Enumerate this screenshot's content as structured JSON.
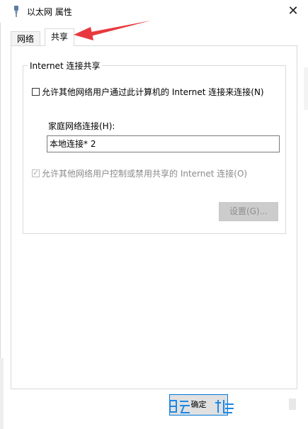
{
  "window": {
    "title": "以太网 属性",
    "close_glyph": "✕"
  },
  "tabs": [
    {
      "label": "网络",
      "active": false
    },
    {
      "label": "共享",
      "active": true
    }
  ],
  "sharing": {
    "group_title": "Internet 连接共享",
    "allow_connect_label": "允许其他网络用户通过此计算机的 Internet 连接来连接(N)",
    "allow_connect_checked": false,
    "home_label": "家庭网络连接(H):",
    "home_value": "本地连接* 2",
    "allow_control_label": "允许其他网络用户控制或禁用共享的 Internet 连接(O)",
    "allow_control_checked": true,
    "settings_button": "设置(G)..."
  },
  "footer": {
    "ok_button": "确定"
  },
  "colors": {
    "annotation_arrow": "#e8383d",
    "focus_border": "#0078d7",
    "watermark": "#1e88e5"
  },
  "icons": {
    "title": "network-adapter-icon",
    "close": "close-icon",
    "checkbox": "checkbox-icon"
  }
}
